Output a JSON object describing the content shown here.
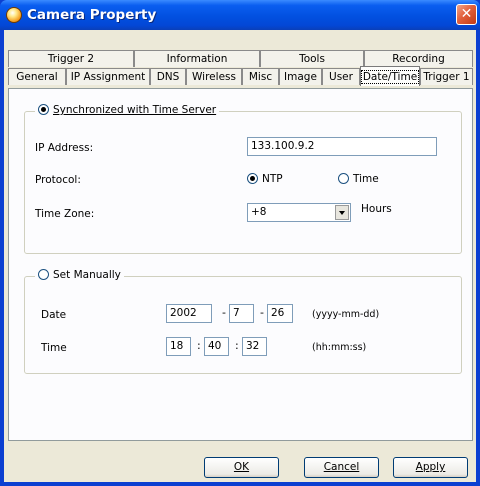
{
  "window": {
    "title": "Camera Property",
    "close_glyph": "✕"
  },
  "tabs_back": [
    "Trigger 2",
    "Information",
    "Tools",
    "Recording"
  ],
  "tabs_front": [
    "General",
    "IP Assignment",
    "DNS",
    "Wireless",
    "Misc",
    "Image",
    "User",
    "Date/Time",
    "Trigger 1"
  ],
  "active_tab": "Date/Time",
  "sync": {
    "label": "Synchronized with Time Server",
    "ip_label": "IP Address:",
    "ip_value": "133.100.9.2",
    "protocol_label": "Protocol:",
    "ntp_label": "NTP",
    "time_label": "Time",
    "timezone_label": "Time Zone:",
    "timezone_value": "+8",
    "hours_label": "Hours"
  },
  "manual": {
    "label": "Set Manually",
    "date_label": "Date",
    "date": {
      "year": "2002",
      "month": "7",
      "day": "26",
      "sep": "-",
      "hint": "(yyyy-mm-dd)"
    },
    "time_label": "Time",
    "time": {
      "hour": "18",
      "minute": "40",
      "second": "32",
      "sep": ":",
      "hint": "(hh:mm:ss)"
    }
  },
  "buttons": {
    "ok": "OK",
    "cancel": "Cancel",
    "apply": "Apply"
  }
}
